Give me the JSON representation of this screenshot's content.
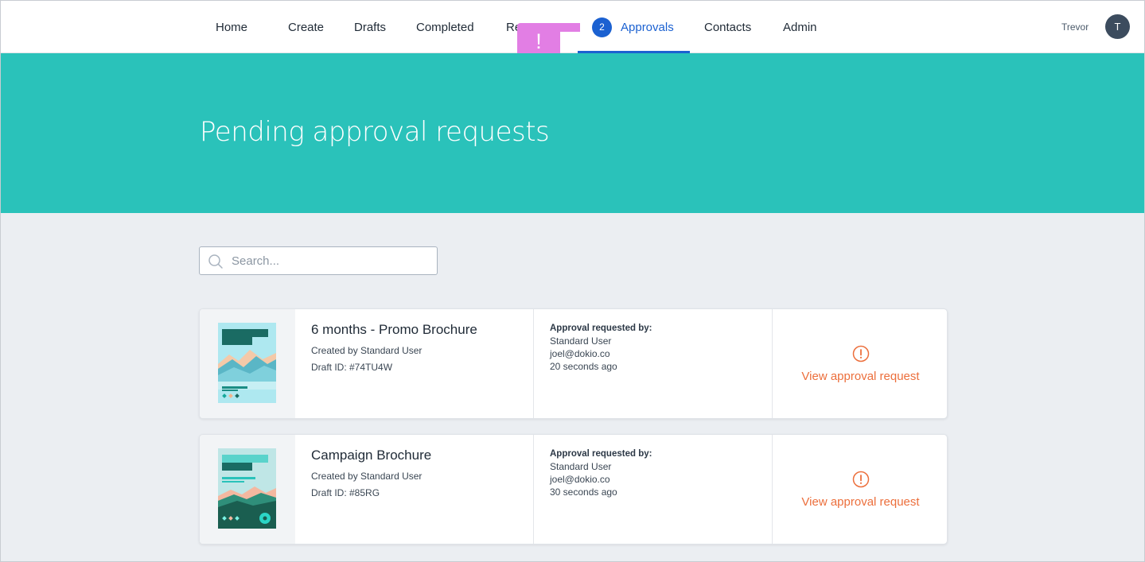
{
  "nav": {
    "items": [
      {
        "label": "Home"
      },
      {
        "label": "Create"
      },
      {
        "label": "Drafts"
      },
      {
        "label": "Completed"
      },
      {
        "label": "Re"
      },
      {
        "label": "Approvals",
        "badge": "2",
        "active": true
      },
      {
        "label": "Contacts"
      },
      {
        "label": "Admin"
      }
    ],
    "user": {
      "name": "Trevor",
      "initial": "T"
    }
  },
  "notification": {
    "symbol": "!",
    "color": "#e27ee4"
  },
  "hero": {
    "title": "Pending approval requests",
    "color": "#2ac2ba"
  },
  "search": {
    "placeholder": "Search...",
    "value": ""
  },
  "requests": [
    {
      "title": "6 months - Promo Brochure",
      "created_by": "Created by Standard User",
      "draft_id": "Draft ID: #74TU4W",
      "approval_label": "Approval requested by:",
      "requester_name": "Standard User",
      "requester_email": "joel@dokio.co",
      "requested_ago": "20 seconds ago",
      "action_label": "View approval request",
      "thumbnail": "brochure-mountains-light"
    },
    {
      "title": "Campaign Brochure",
      "created_by": "Created by Standard User",
      "draft_id": "Draft ID: #85RG",
      "approval_label": "Approval requested by:",
      "requester_name": "Standard User",
      "requester_email": "joel@dokio.co",
      "requested_ago": "30 seconds ago",
      "action_label": "View approval request",
      "thumbnail": "brochure-mountains-dark"
    }
  ],
  "colors": {
    "accent": "#1b61d1",
    "action": "#ec6f3c",
    "teal": "#2ac2ba"
  }
}
